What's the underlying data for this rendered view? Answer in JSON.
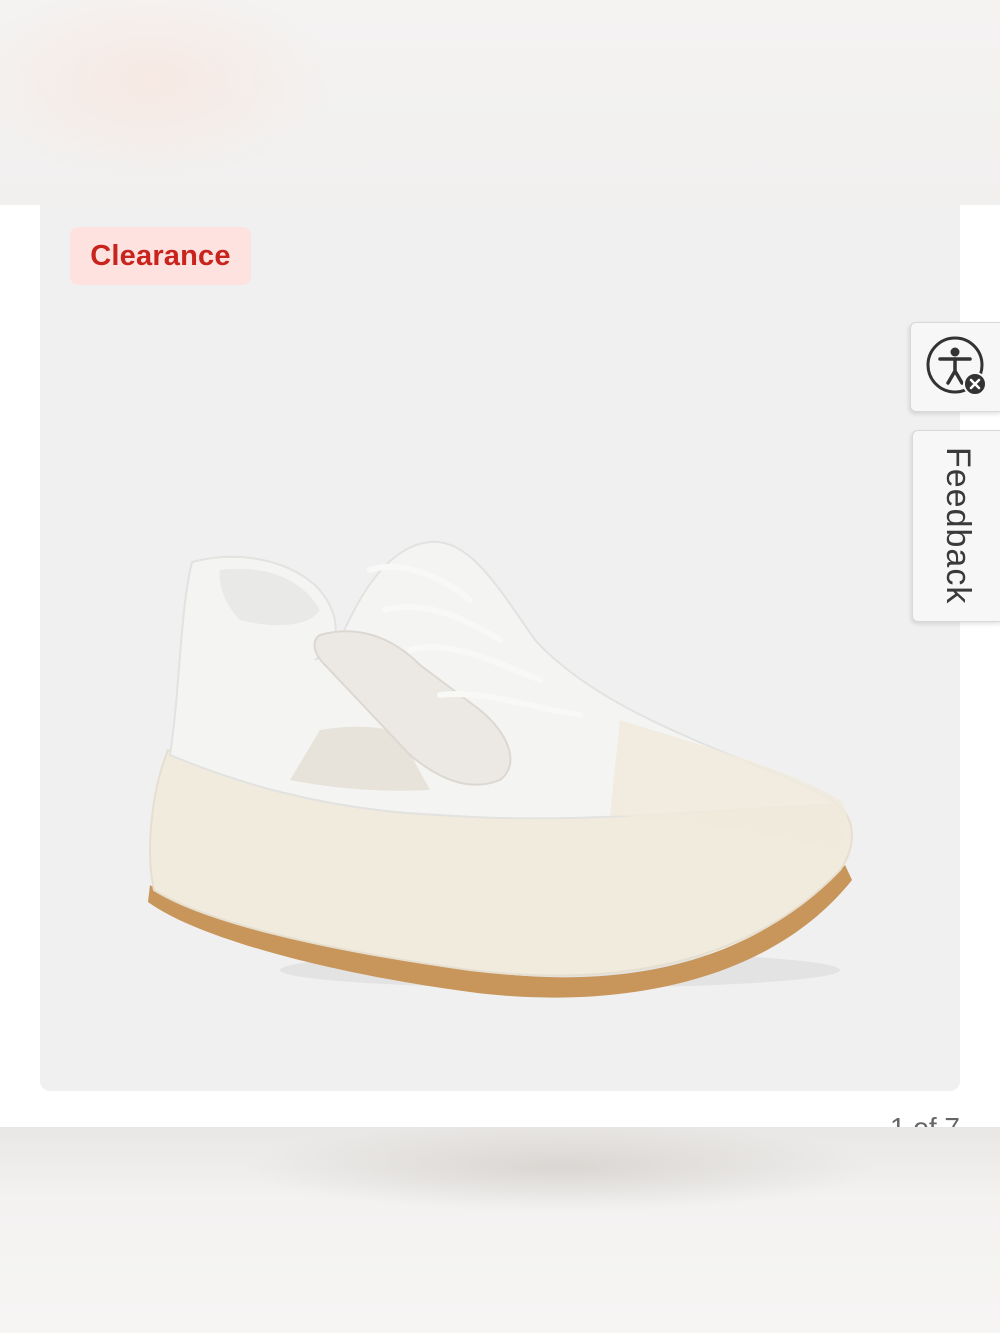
{
  "product": {
    "badge_label": "Clearance",
    "image_alt": "White knit sneaker with gum sole",
    "counter": "1 of 7"
  },
  "side_tabs": {
    "accessibility_icon": "accessibility-icon",
    "feedback_label": "Feedback"
  },
  "colors": {
    "badge_bg": "#fde2e0",
    "badge_text": "#c8231c",
    "card_bg": "#f0f0f0"
  }
}
